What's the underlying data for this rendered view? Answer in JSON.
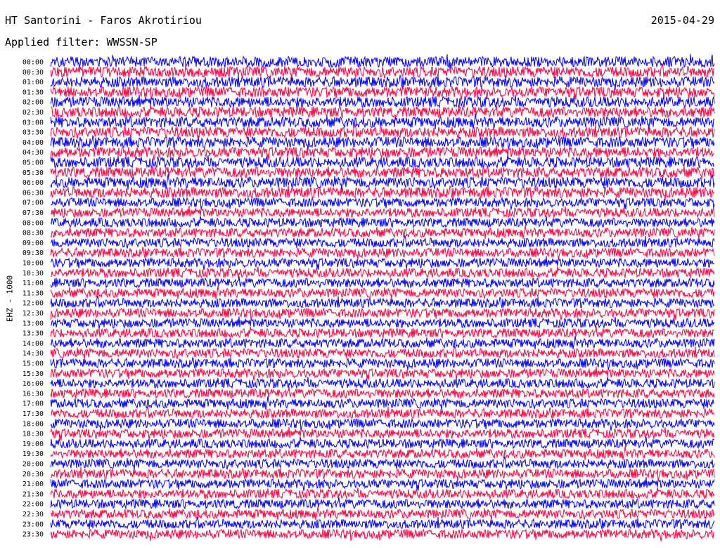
{
  "header": {
    "title": "HT Santorini - Faros Akrotiriou",
    "date": "2015-04-29",
    "filter": "Applied filter: WWSSN-SP"
  },
  "chart_data": {
    "type": "line",
    "title": "HT Santorini - Faros Akrotiriou",
    "ylabel": "EHZ - 1000",
    "row_labels": [
      "00:00",
      "00:30",
      "01:00",
      "01:30",
      "02:00",
      "02:30",
      "03:00",
      "03:30",
      "04:00",
      "04:30",
      "05:00",
      "05:30",
      "06:00",
      "06:30",
      "07:00",
      "07:30",
      "08:00",
      "08:30",
      "09:00",
      "09:30",
      "10:00",
      "10:30",
      "11:00",
      "11:30",
      "12:00",
      "12:30",
      "13:00",
      "13:30",
      "14:00",
      "14:30",
      "15:00",
      "15:30",
      "16:00",
      "16:30",
      "17:00",
      "17:30",
      "18:00",
      "18:30",
      "19:00",
      "19:30",
      "20:00",
      "20:30",
      "21:00",
      "21:30",
      "22:00",
      "22:30",
      "23:00",
      "23:30"
    ],
    "colors": [
      "#0000ff",
      "#ff0040"
    ],
    "grid": false
  }
}
